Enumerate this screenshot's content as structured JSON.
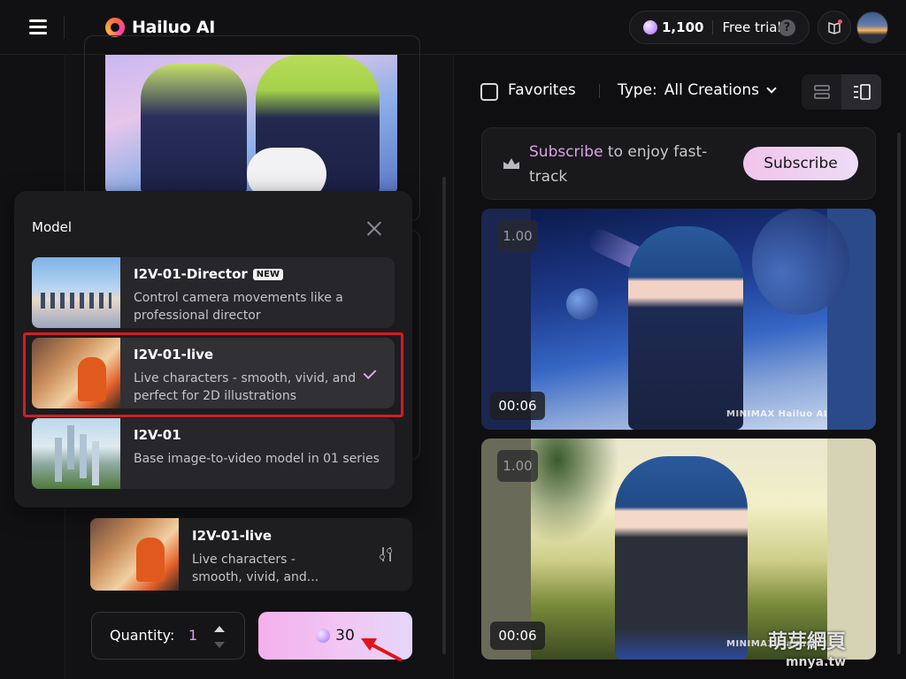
{
  "header": {
    "logo_text": "Hailuo AI",
    "credits": "1,100",
    "free_trial": "Free trial",
    "help_glyph": "?"
  },
  "model_popup": {
    "title": "Model",
    "models": [
      {
        "name": "I2V-01-Director",
        "badge": "NEW",
        "description": "Control camera movements like a professional director",
        "selected": false
      },
      {
        "name": "I2V-01-live",
        "badge": "",
        "description": "Live characters - smooth, vivid, and perfect for 2D illustrations",
        "selected": true
      },
      {
        "name": "I2V-01",
        "badge": "",
        "description": "Base image-to-video model in 01 series",
        "selected": false
      }
    ]
  },
  "selected_model": {
    "name": "I2V-01-live",
    "description": "Live characters - smooth, vivid, and..."
  },
  "generate": {
    "quantity_label": "Quantity:",
    "quantity_value": "1",
    "cost": "30"
  },
  "filters": {
    "favorites_label": "Favorites",
    "type_label": "Type:",
    "type_value": "All Creations"
  },
  "subscribe": {
    "text_highlight": "Subscribe",
    "text_rest": " to enjoy fast-track",
    "button_label": "Subscribe"
  },
  "videos": [
    {
      "ratio": "1.00",
      "duration": "00:06",
      "watermark": "MINIMAX  Hailuo AI"
    },
    {
      "ratio": "1.00",
      "duration": "00:06",
      "watermark": "MINIMAX  Hailuo AI"
    }
  ],
  "site_watermark": {
    "line1": "萌芽網頁",
    "line2": "mnya.tw"
  },
  "colors": {
    "accent_pink": "#dfa0e8",
    "highlight_red": "#d21d24",
    "background": "#0f0f11"
  },
  "icons": [
    "menu-icon",
    "logo-icon",
    "gem-icon",
    "help-icon",
    "book-icon",
    "close-icon",
    "check-icon",
    "tune-icon",
    "crown-icon",
    "list-view-icon",
    "grid-view-icon",
    "chevron-down-icon",
    "arrow-icon"
  ]
}
